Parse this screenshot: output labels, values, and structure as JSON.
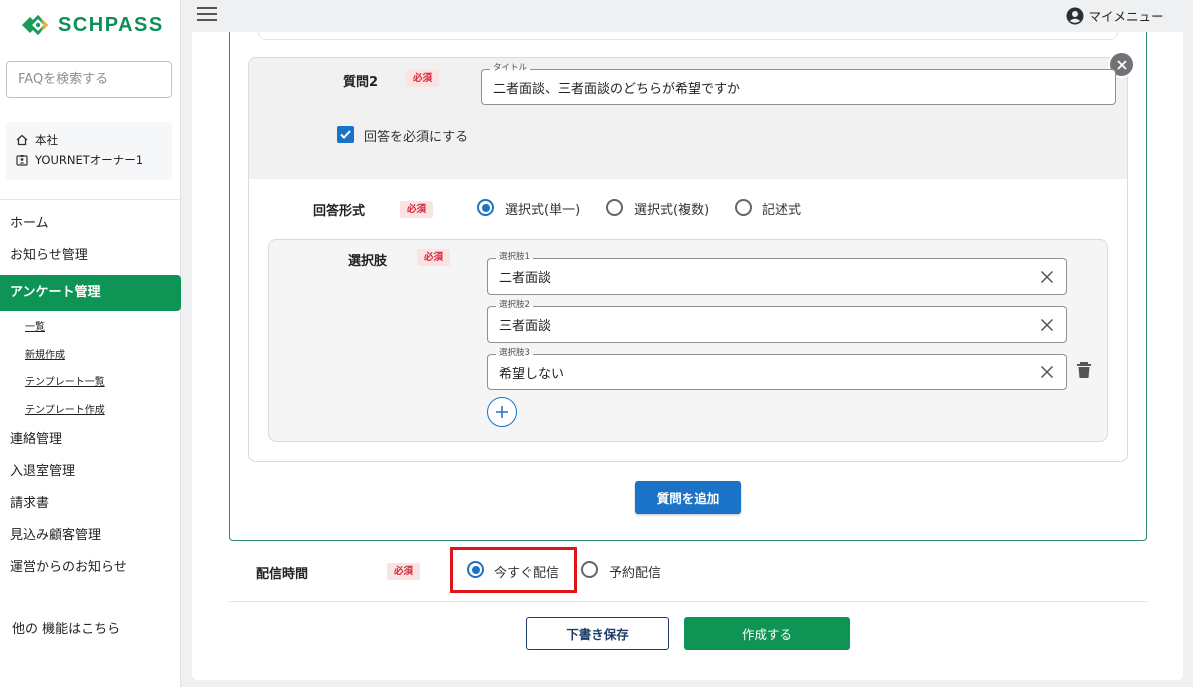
{
  "brand": {
    "name": "SCHPASS",
    "color": "#0e9455"
  },
  "sidebar": {
    "faq_placeholder": "FAQを検索する",
    "org": {
      "branch": "本社",
      "user": "YOURNETオーナー1"
    },
    "nav": {
      "home": "ホーム",
      "news": "お知らせ管理",
      "survey": "アンケート管理",
      "survey_sub": [
        "一覧",
        "新規作成",
        "テンプレート一覧",
        "テンプレート作成"
      ],
      "contact": "連絡管理",
      "attendance": "入退室管理",
      "invoice": "請求書",
      "prospects": "見込み顧客管理",
      "ops_news": "運営からのお知らせ",
      "other": "他の 機能はこちら"
    }
  },
  "header": {
    "my_menu": "マイメニュー"
  },
  "question": {
    "label": "質問2",
    "required": "必須",
    "title_legend": "タイトル",
    "title_value": "二者面談、三者面談のどちらが希望ですか",
    "required_checkbox": "回答を必須にする",
    "answer_format": {
      "label": "回答形式",
      "options": [
        "選択式(単一)",
        "選択式(複数)",
        "記述式"
      ],
      "selected": "選択式(単一)"
    },
    "choices": {
      "label": "選択肢",
      "items": [
        {
          "legend": "選択肢1",
          "value": "二者面談"
        },
        {
          "legend": "選択肢2",
          "value": "三者面談"
        },
        {
          "legend": "選択肢3",
          "value": "希望しない"
        }
      ]
    }
  },
  "add_question_button": "質問を追加",
  "delivery": {
    "label": "配信時間",
    "options": [
      "今すぐ配信",
      "予約配信"
    ],
    "selected": "今すぐ配信"
  },
  "footer": {
    "draft_button": "下書き保存",
    "create_button": "作成する"
  },
  "colors": {
    "primary_blue": "#1a73c7",
    "required_red": "#d6283a",
    "highlight_red": "#e0151b"
  }
}
